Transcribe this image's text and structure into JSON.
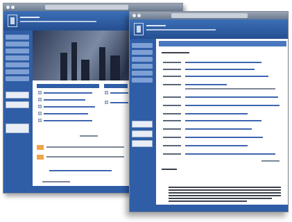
{
  "screens": [
    {
      "id": "back",
      "nav_item_count": 7,
      "hero_image": "city-skyline-photo",
      "panels": 2
    },
    {
      "id": "front",
      "nav_item_count": 6,
      "list_row_count": 14
    }
  ],
  "colors": {
    "header": "#2f5ea6",
    "sidebar": "#2f5ea6",
    "nav_item": "#7ea0d4",
    "accent_orange": "#f1a548",
    "page_bg": "#ffffff"
  }
}
